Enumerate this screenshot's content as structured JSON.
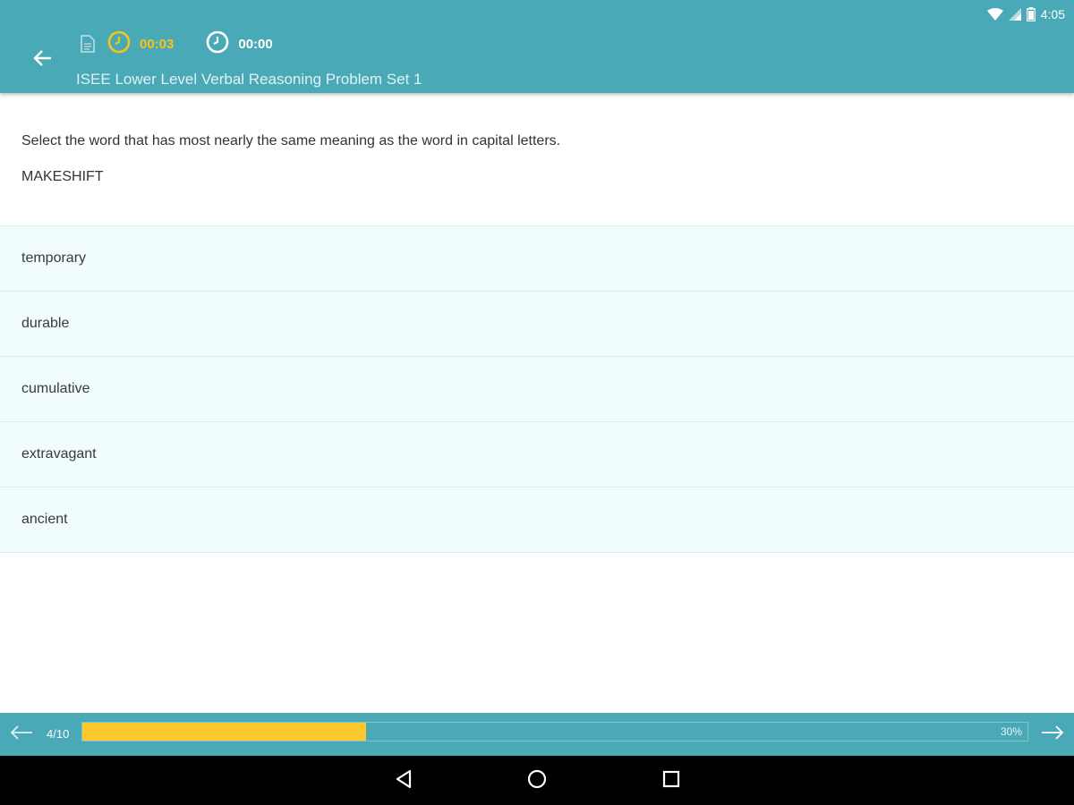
{
  "status_bar": {
    "time": "4:05",
    "icons": [
      "wifi-icon",
      "cell-signal-icon",
      "battery-icon"
    ]
  },
  "toolbar": {
    "back_icon": "arrow-left-icon",
    "question_timer": "00:03",
    "total_timer": "00:00",
    "title": "ISEE Lower Level Verbal Reasoning Problem Set 1",
    "accent_color": "#f5c518",
    "bar_color": "#4aa9b6"
  },
  "question": {
    "prompt": "Select the word that has most nearly the same meaning as the word in capital letters.",
    "word": "MAKESHIFT"
  },
  "answers": [
    {
      "label": "temporary"
    },
    {
      "label": "durable"
    },
    {
      "label": "cumulative"
    },
    {
      "label": "extravagant"
    },
    {
      "label": "ancient"
    }
  ],
  "footer": {
    "counter": "4/10",
    "progress_percent": 30,
    "progress_label": "30%",
    "progress_color": "#fdc72e"
  },
  "system_nav": {
    "icons": [
      "nav-back-icon",
      "nav-home-icon",
      "nav-recents-icon"
    ]
  }
}
